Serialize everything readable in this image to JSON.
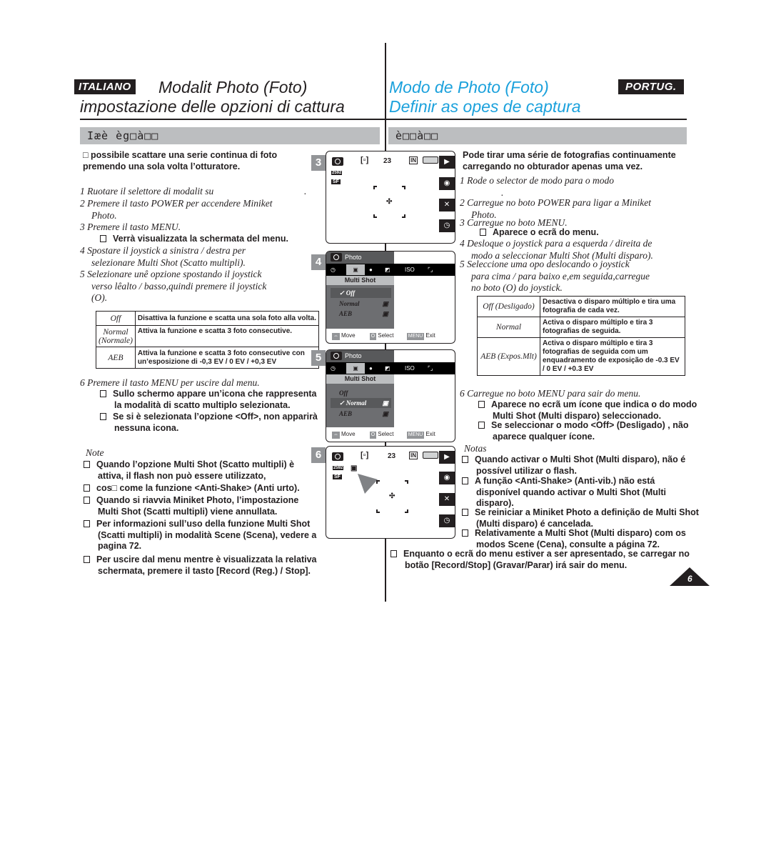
{
  "italian": {
    "lang_badge": "ITALIANO",
    "title_line1": "Modalit Photo (Foto)",
    "title_line2": "impostazione delle opzioni di cattura",
    "section_bar": "Iæè èg□à□□",
    "intro": [
      "□ possibile scattare una serie continua di foto",
      "premendo una sola volta l’otturatore."
    ],
    "steps": [
      {
        "lines": [
          "1 Ruotare il selettore di modalit su",
          "."
        ]
      },
      {
        "lines": [
          "2 Premere il tasto POWER per accendere Miniket",
          "Photo."
        ]
      },
      {
        "lines": [
          "3 Premere il tasto MENU."
        ]
      },
      {
        "lines": [
          "4 Spostare il joystick a sinistra / destra per",
          "selezionare Multi Shot (Scatto multipli)."
        ]
      },
      {
        "lines": [
          "5 Selezionare unê opzione spostando il joystick",
          "verso lêalto / basso,quindi premere il joystick",
          "(O)."
        ]
      },
      {
        "lines": [
          "6 Premere il tasto MENU per uscire dal menu."
        ]
      }
    ],
    "step3_bullet": "Verrà visualizzata la schermata del menu.",
    "table": [
      {
        "key": "Off",
        "desc": "Disattiva la funzione e scatta una sola foto alla volta."
      },
      {
        "key": "Normal (Normale)",
        "desc": "Attiva la funzione e scatta 3 foto consecutive."
      },
      {
        "key": "AEB",
        "desc": "Attiva la funzione e scatta 3 foto consecutive con un’esposizione di -0,3 EV / 0 EV / +0,3 EV"
      }
    ],
    "step6_bullets": [
      [
        "Sullo schermo appare un’icona che rappresenta",
        "la modalità di scatto multiplo selezionata."
      ],
      [
        "Se si è selezionata l’opzione <Off>, non apparirà",
        "nessuna icona."
      ]
    ],
    "note_title": "Note",
    "notes": [
      [
        "Quando l’opzione Multi Shot (Scatto multipli) è",
        "attiva, il flash non può essere utilizzato,"
      ],
      [
        "cos□ come la funzione <Anti-Shake> (Anti urto)."
      ],
      [
        "Quando si riavvia Miniket Photo, l’impostazione",
        "Multi Shot (Scatti multipli) viene annullata."
      ],
      [
        "Per informazioni sull’uso della funzione Multi Shot",
        "(Scatti multipli) in modalità Scene (Scena), vedere a",
        "pagina 72."
      ],
      [
        "Per uscire dal menu mentre è visualizzata la relativa",
        "schermata, premere il tasto [Record (Reg.) / Stop]."
      ]
    ]
  },
  "portuguese": {
    "lang_badge": "PORTUG.",
    "title_line1": "Modo de Photo (Foto)",
    "title_line2": "Definir as opes de captura",
    "section_bar": "è□□à□□",
    "intro": [
      "Pode tirar uma série de fotografias continuamente",
      "carregando no obturador apenas uma vez."
    ],
    "steps": [
      {
        "lines": [
          "1 Rode o selector de modo para o modo",
          "."
        ]
      },
      {
        "lines": [
          "2 Carregue no boto POWER para ligar a Miniket",
          "Photo."
        ]
      },
      {
        "lines": [
          "3 Carregue no boto MENU."
        ]
      },
      {
        "lines": [
          "4 Desloque o joystick para a esquerda / direita de",
          "modo a seleccionar Multi Shot (Multi disparo)."
        ]
      },
      {
        "lines": [
          "5 Seleccione uma opo deslocando o joystick",
          "para cima / para baixo e,em seguida,carregue",
          "no boto (O) do joystick."
        ]
      },
      {
        "lines": [
          "6 Carregue no boto MENU para sair do menu."
        ]
      }
    ],
    "step3_bullet": "Aparece o ecrã do menu.",
    "table": [
      {
        "key": "Off (Desligado)",
        "desc": "Desactiva o disparo múltiplo e tira uma fotografia de cada vez."
      },
      {
        "key": "Normal",
        "desc": "Activa o disparo múltiplo e tira 3 fotografias de seguida."
      },
      {
        "key": "AEB (Expos.Mlt)",
        "desc": "Activa o disparo múltiplo e tira 3 fotografias de seguida com um enquadramento de exposição de -0.3 EV / 0 EV / +0.3 EV"
      }
    ],
    "step6_bullets": [
      [
        "Aparece no ecrã um ícone que indica o do modo",
        "Multi Shot (Multi disparo) seleccionado."
      ],
      [
        "Se seleccionar o modo <Off> (Desligado) , não",
        "aparece qualquer ícone."
      ]
    ],
    "note_title": "Notas",
    "notes": [
      [
        "Quando activar o Multi Shot (Multi disparo), não é",
        "possível utilizar o flash."
      ],
      [
        "A função <Anti-Shake> (Anti-vib.) não está",
        "disponível quando activar o Multi Shot (Multi",
        "disparo)."
      ],
      [
        "Se reiniciar a Miniket Photo a definição de Multi Shot",
        "(Multi disparo) é cancelada."
      ],
      [
        "Relativamente a Multi Shot (Multi disparo) com os",
        "modos Scene (Cena), consulte a página 72."
      ],
      [
        "Enquanto o ecrã do menu estiver a ser apresentado, se carregar no",
        "botão [Record/Stop] (Gravar/Parar) irá sair do menu."
      ]
    ]
  },
  "screens": {
    "step_numbers": [
      "3",
      "4",
      "5",
      "6"
    ],
    "shots_remaining": "23",
    "memory": "IN",
    "resolution_icon": "2592",
    "quality_icon": "SF",
    "menu_header": "Photo",
    "menu_strip": [
      "self-timer-icon",
      "multi-shot-icon",
      "effect-icon",
      "exposure-icon",
      "ISO",
      "wide-icon"
    ],
    "menu_iso": "ISO",
    "menu_title": "Multi Shot",
    "menu_options": [
      "Off",
      "Normal",
      "AEB"
    ],
    "screen4_selected": "Off",
    "screen5_selected": "Normal",
    "footer": {
      "move": "Move",
      "select_key": "O",
      "select": "Select",
      "menu_key": "MENU",
      "exit": "Exit"
    }
  },
  "page_number": "6"
}
